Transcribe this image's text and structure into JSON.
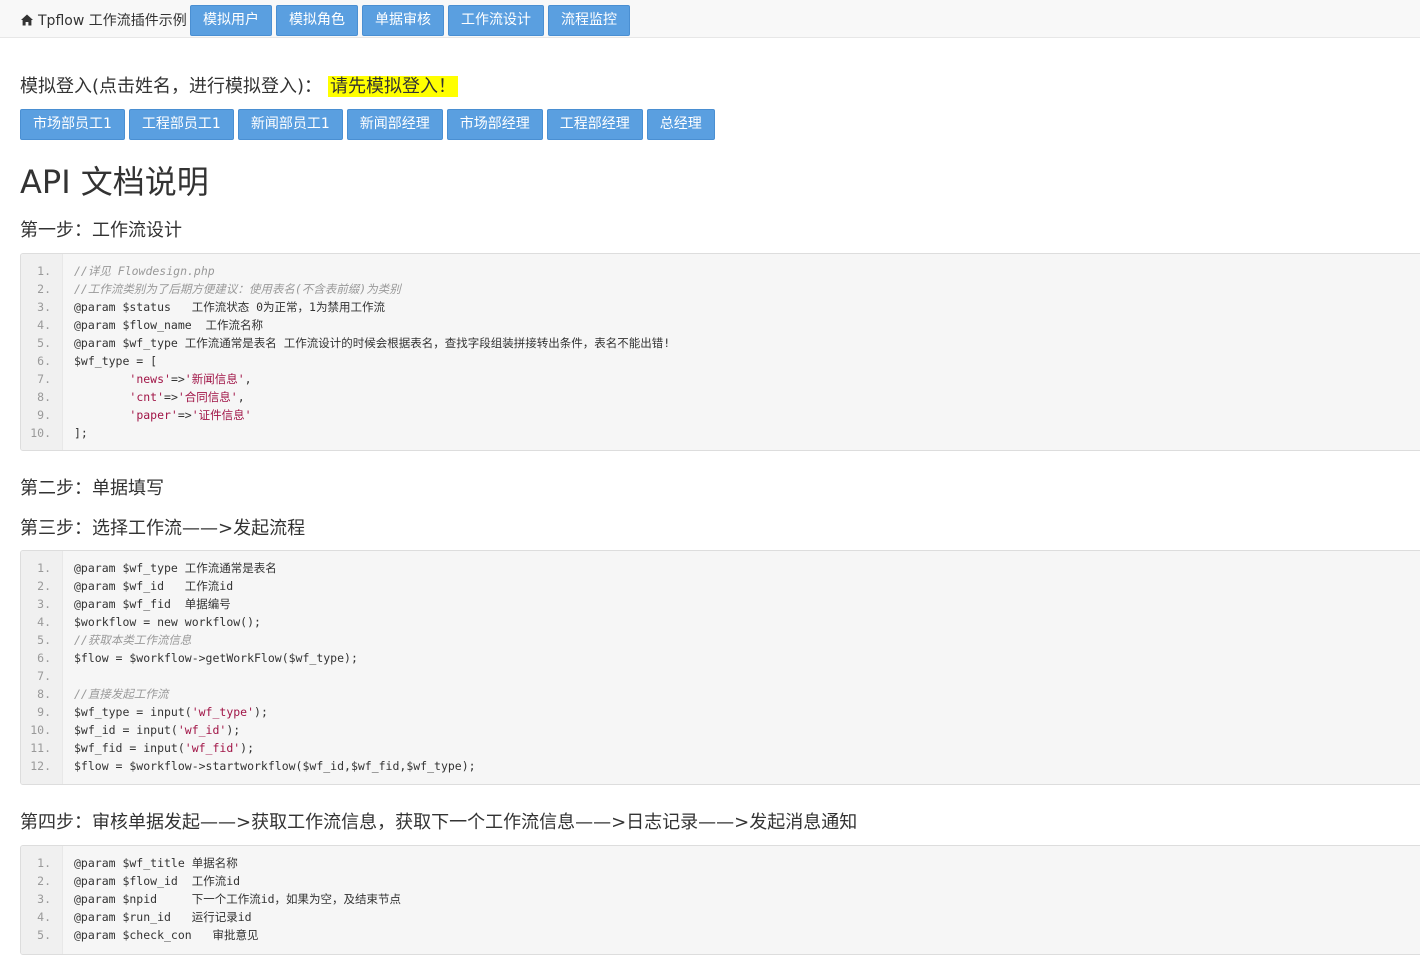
{
  "header": {
    "brand": "Tpflow 工作流插件示例",
    "nav": [
      "模拟用户",
      "模拟角色",
      "单据审核",
      "工作流设计",
      "流程监控"
    ]
  },
  "login": {
    "prompt": "模拟登入(点击姓名，进行模拟登入)：",
    "highlight": "请先模拟登入！",
    "users": [
      "市场部员工1",
      "工程部员工1",
      "新闻部员工1",
      "新闻部经理",
      "市场部经理",
      "工程部经理",
      "总经理"
    ]
  },
  "doc": {
    "title": "API 文档说明",
    "steps": [
      "第一步：工作流设计",
      "第二步：单据填写",
      "第三步：选择工作流——>发起流程",
      "第四步：审核单据发起——>获取工作流信息，获取下一个工作流信息——>日志记录——>发起消息通知"
    ]
  },
  "code_blocks": [
    {
      "lines": [
        [
          {
            "t": "//详见 Flowdesign.php",
            "c": "com"
          }
        ],
        [
          {
            "t": "//工作流类别为了后期方便建议：使用表名(不含表前缀)为类别",
            "c": "com"
          }
        ],
        [
          {
            "t": "@param $status   工作流状态 0为正常，1为禁用工作流",
            "c": "def"
          }
        ],
        [
          {
            "t": "@param $flow_name  工作流名称",
            "c": "def"
          }
        ],
        [
          {
            "t": "@param $wf_type 工作流通常是表名 工作流设计的时候会根据表名，查找字段组装拼接转出条件，表名不能出错!",
            "c": "def"
          }
        ],
        [
          {
            "t": "$wf_type = [",
            "c": "def"
          }
        ],
        [
          {
            "t": "        ",
            "c": "def"
          },
          {
            "t": "'news'",
            "c": "str"
          },
          {
            "t": "=>",
            "c": "def"
          },
          {
            "t": "'新闻信息'",
            "c": "str"
          },
          {
            "t": ",",
            "c": "def"
          }
        ],
        [
          {
            "t": "        ",
            "c": "def"
          },
          {
            "t": "'cnt'",
            "c": "str"
          },
          {
            "t": "=>",
            "c": "def"
          },
          {
            "t": "'合同信息'",
            "c": "str"
          },
          {
            "t": ",",
            "c": "def"
          }
        ],
        [
          {
            "t": "        ",
            "c": "def"
          },
          {
            "t": "'paper'",
            "c": "str"
          },
          {
            "t": "=>",
            "c": "def"
          },
          {
            "t": "'证件信息'",
            "c": "str"
          }
        ],
        [
          {
            "t": "];",
            "c": "def"
          }
        ]
      ]
    },
    {
      "lines": [
        [
          {
            "t": "@param $wf_type 工作流通常是表名",
            "c": "def"
          }
        ],
        [
          {
            "t": "@param $wf_id   工作流id",
            "c": "def"
          }
        ],
        [
          {
            "t": "@param $wf_fid  单据编号",
            "c": "def"
          }
        ],
        [
          {
            "t": "$workflow = new workflow();",
            "c": "def"
          }
        ],
        [
          {
            "t": "//获取本类工作流信息",
            "c": "com"
          }
        ],
        [
          {
            "t": "$flow = $workflow->getWorkFlow($wf_type);",
            "c": "def"
          }
        ],
        [
          {
            "t": "",
            "c": "def"
          }
        ],
        [
          {
            "t": "//直接发起工作流",
            "c": "com"
          }
        ],
        [
          {
            "t": "$wf_type = input(",
            "c": "def"
          },
          {
            "t": "'wf_type'",
            "c": "str"
          },
          {
            "t": ");",
            "c": "def"
          }
        ],
        [
          {
            "t": "$wf_id = input(",
            "c": "def"
          },
          {
            "t": "'wf_id'",
            "c": "str"
          },
          {
            "t": ");",
            "c": "def"
          }
        ],
        [
          {
            "t": "$wf_fid = input(",
            "c": "def"
          },
          {
            "t": "'wf_fid'",
            "c": "str"
          },
          {
            "t": ");",
            "c": "def"
          }
        ],
        [
          {
            "t": "$flow = $workflow->startworkflow($wf_id,$wf_fid,$wf_type);",
            "c": "def"
          }
        ]
      ]
    },
    {
      "lines": [
        [
          {
            "t": "@param $wf_title 单据名称",
            "c": "def"
          }
        ],
        [
          {
            "t": "@param $flow_id  工作流id",
            "c": "def"
          }
        ],
        [
          {
            "t": "@param $npid     下一个工作流id，如果为空，及结束节点",
            "c": "def"
          }
        ],
        [
          {
            "t": "@param $run_id   运行记录id",
            "c": "def"
          }
        ],
        [
          {
            "t": "@param $check_con   审批意见",
            "c": "def"
          }
        ]
      ]
    }
  ]
}
